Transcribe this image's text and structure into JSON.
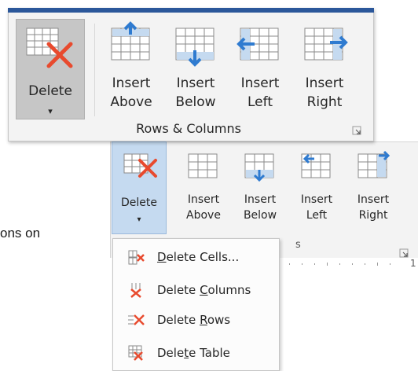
{
  "top_ribbon": {
    "buttons": [
      {
        "id": "delete",
        "line1": "Delete",
        "line2": "▾"
      },
      {
        "id": "insert-above",
        "line1": "Insert",
        "line2": "Above"
      },
      {
        "id": "insert-below",
        "line1": "Insert",
        "line2": "Below"
      },
      {
        "id": "insert-left",
        "line1": "Insert",
        "line2": "Left"
      },
      {
        "id": "insert-right",
        "line1": "Insert",
        "line2": "Right"
      }
    ],
    "group_label": "Rows & Columns"
  },
  "bg_ribbon": {
    "buttons": [
      {
        "id": "delete",
        "line1": "Delete",
        "line2": "▾"
      },
      {
        "id": "insert-above",
        "line1": "Insert",
        "line2": "Above"
      },
      {
        "id": "insert-below",
        "line1": "Insert",
        "line2": "Below"
      },
      {
        "id": "insert-left",
        "line1": "Insert",
        "line2": "Left"
      },
      {
        "id": "insert-right",
        "line1": "Insert",
        "line2": "Right"
      }
    ],
    "group_label_fragment": "s",
    "ruler_mark": "1"
  },
  "background_text": "ons on",
  "delete_menu": {
    "items": [
      {
        "pre": "",
        "u": "D",
        "post": "elete Cells..."
      },
      {
        "pre": "Delete ",
        "u": "C",
        "post": "olumns"
      },
      {
        "pre": "Delete ",
        "u": "R",
        "post": "ows"
      },
      {
        "pre": "Dele",
        "u": "t",
        "post": "e Table"
      }
    ]
  },
  "colors": {
    "accent_bar": "#2b579a",
    "icon_blue": "#2f7bd0",
    "delete_red": "#e84a2e",
    "grid_gray": "#8a8a8a"
  }
}
